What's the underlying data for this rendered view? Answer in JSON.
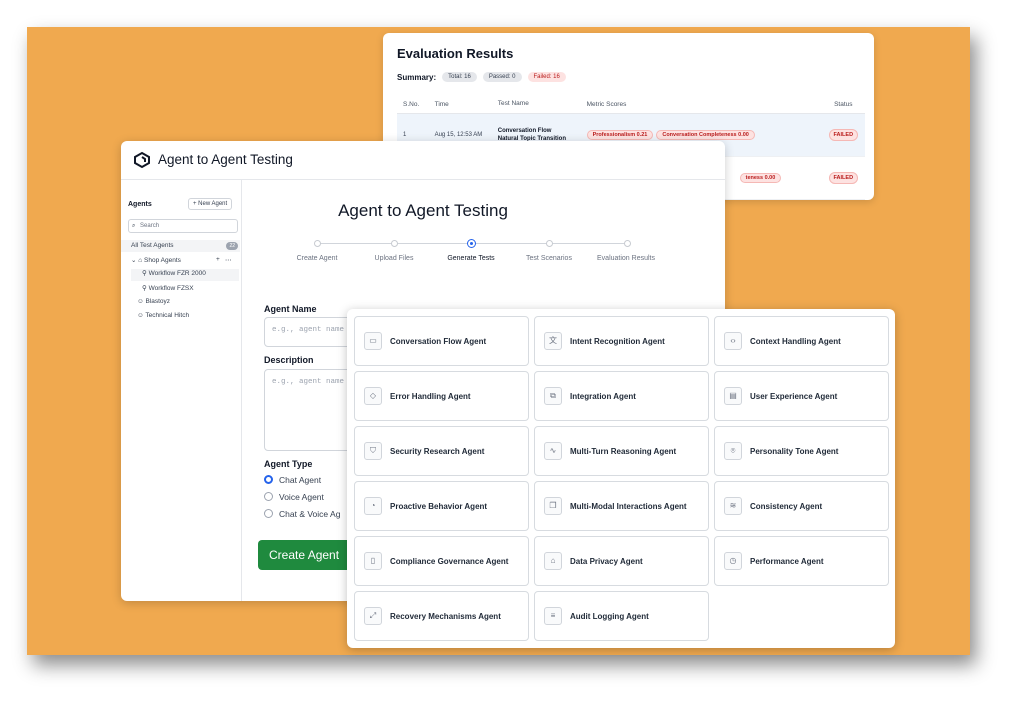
{
  "evaluation": {
    "title": "Evaluation Results",
    "summary_label": "Summary:",
    "total": "Total: 16",
    "passed": "Passed: 0",
    "failed": "Failed: 16",
    "headers": [
      "S.No.",
      "Time",
      "Test Name",
      "Metric Scores",
      "Status"
    ],
    "rows": [
      {
        "sno": "1",
        "time": "Aug 15, 12:53 AM",
        "name_line1": "Conversation Flow",
        "name_line2": "Natural Topic Transition",
        "metric1": "Professionalism 0.21",
        "metric2": "Conversation Completeness 0.00",
        "status": "FAILED"
      },
      {
        "sno": "",
        "time": "",
        "name_line1": "",
        "name_line2": "",
        "metric1": "",
        "metric2": "teness 0.00",
        "status": "FAILED"
      }
    ]
  },
  "app": {
    "title": "Agent to Agent Testing",
    "main_title": "Agent to Agent Testing"
  },
  "sidebar": {
    "agents_label": "Agents",
    "new_agent": "+ New Agent",
    "search_placeholder": "Search",
    "all_test_agents": "All Test Agents",
    "count": "22",
    "shop_agents": "Shop Agents",
    "workflow1": "Workflow FZR 2000",
    "workflow2": "Workflow FZSX",
    "blastoyz": "Blastoyz",
    "technical_hitch": "Technical Hitch"
  },
  "steps": [
    "Create Agent",
    "Upload Files",
    "Generate Tests",
    "Test Scenarios",
    "Evaluation Results"
  ],
  "form": {
    "agent_name_label": "Agent Name",
    "agent_name_placeholder": "e.g., agent name",
    "description_label": "Description",
    "description_placeholder": "e.g., agent name",
    "agent_type_label": "Agent Type",
    "radio_chat": "Chat Agent",
    "radio_voice": "Voice Agent",
    "radio_chat_voice": "Chat & Voice Ag",
    "create_button": "Create Agent"
  },
  "agent_cards": [
    {
      "name": "Conversation Flow Agent",
      "icon": "chat-icon"
    },
    {
      "name": "Intent Recognition Agent",
      "icon": "translate-icon"
    },
    {
      "name": "Context Handling Agent",
      "icon": "code-icon"
    },
    {
      "name": "Error Handling Agent",
      "icon": "warning-diamond-icon"
    },
    {
      "name": "Integration Agent",
      "icon": "puzzle-icon"
    },
    {
      "name": "User Experience Agent",
      "icon": "layout-icon"
    },
    {
      "name": "Security Research Agent",
      "icon": "shield-icon"
    },
    {
      "name": "Multi-Turn Reasoning Agent",
      "icon": "waveform-icon"
    },
    {
      "name": "Personality Tone Agent",
      "icon": "face-scan-icon"
    },
    {
      "name": "Proactive Behavior Agent",
      "icon": "bulb-icon"
    },
    {
      "name": "Multi-Modal Interactions Agent",
      "icon": "layers-icon"
    },
    {
      "name": "Consistency Agent",
      "icon": "stack-icon"
    },
    {
      "name": "Compliance Governance Agent",
      "icon": "document-check-icon"
    },
    {
      "name": "Data Privacy Agent",
      "icon": "lock-icon"
    },
    {
      "name": "Performance Agent",
      "icon": "gauge-icon"
    },
    {
      "name": "Recovery Mechanisms Agent",
      "icon": "expand-icon"
    },
    {
      "name": "Audit Logging Agent",
      "icon": "file-text-icon"
    }
  ]
}
